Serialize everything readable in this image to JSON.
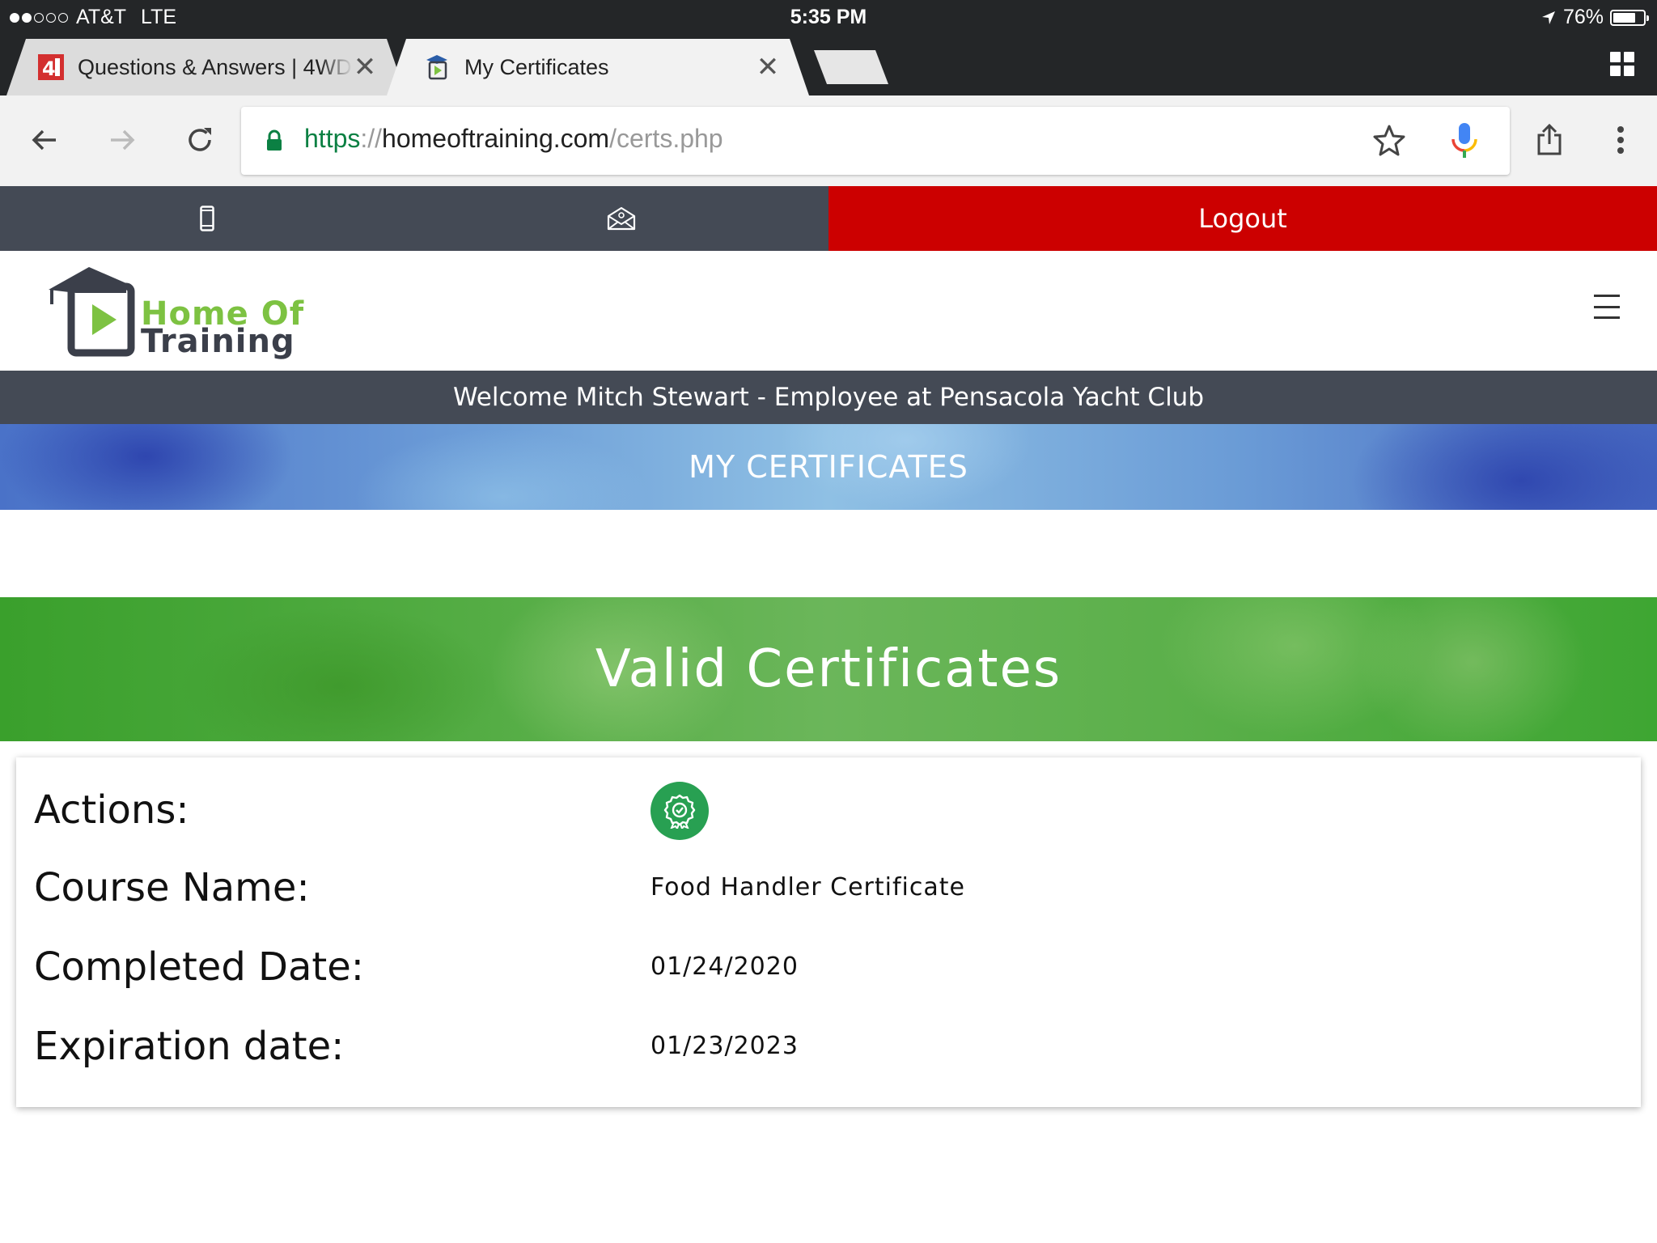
{
  "status_bar": {
    "carrier": "AT&T",
    "network": "LTE",
    "time": "5:35 PM",
    "battery_percent": "76%",
    "battery_level": 0.76,
    "signal_bars_filled": 2,
    "signal_bars_total": 5
  },
  "tabs": [
    {
      "title": "Questions & Answers | 4WD",
      "favicon": "4wd-favicon-icon",
      "active": false
    },
    {
      "title": "My Certificates",
      "favicon": "home-of-training-favicon-icon",
      "active": true
    }
  ],
  "toolbar": {
    "url_scheme": "https",
    "url_separator": "://",
    "url_host": "homeoftraining.com",
    "url_path": "/certs.php"
  },
  "site": {
    "logout_label": "Logout",
    "logo_line1": "Home Of",
    "logo_line2": "Training",
    "welcome_text": "Welcome Mitch Stewart - Employee at Pensacola Yacht Club",
    "page_heading": "MY CERTIFICATES",
    "section_heading": "Valid Certificates",
    "colors": {
      "logout_red": "#cc0000",
      "topbar_gray": "#444a55",
      "logo_green": "#7dc242",
      "cert_button_green": "#28a052"
    }
  },
  "certificate": {
    "actions_label": "Actions:",
    "course_name_label": "Course Name:",
    "course_name": "Food Handler Certificate",
    "completed_label": "Completed Date:",
    "completed_date": "01/24/2020",
    "expiration_label": "Expiration date:",
    "expiration_date": "01/23/2023",
    "action_icon": "certificate-badge-icon"
  }
}
